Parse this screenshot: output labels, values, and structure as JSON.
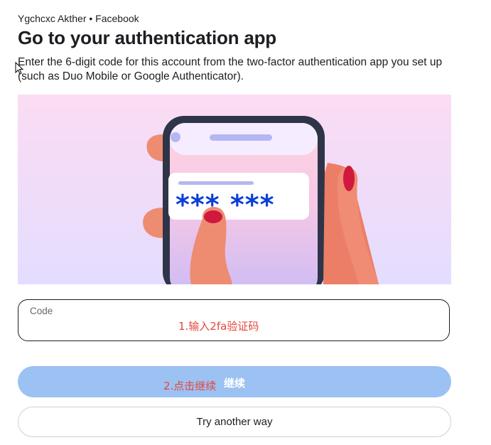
{
  "header": {
    "account_line": "Ygchcxc Akther • Facebook",
    "title": "Go to your authentication app",
    "description": "Enter the 6-digit code for this account from the two-factor authentication app you set up (such as Duo Mobile or Google Authenticator)."
  },
  "illustration": {
    "masked_code": "*** ***"
  },
  "form": {
    "code_label": "Code",
    "code_value": "",
    "annotation_1": "1.输入2fa验证码"
  },
  "buttons": {
    "continue_label": "继续",
    "annotation_2": "2.点击继续",
    "try_another_label": "Try another way"
  },
  "colors": {
    "continue_disabled_bg": "#9cc1f3",
    "annotation_red": "#e4473b",
    "accent_blue": "#0a3fd6"
  }
}
